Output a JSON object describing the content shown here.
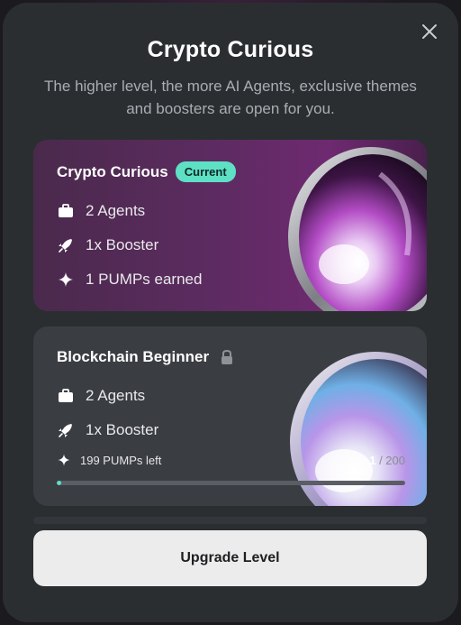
{
  "modal": {
    "title": "Crypto Curious",
    "subtitle": "The higher level, the more AI Agents, exclusive themes and boosters are open for you.",
    "close_icon": "close-icon"
  },
  "current_level": {
    "name": "Crypto Curious",
    "badge": "Current",
    "features": [
      {
        "icon": "briefcase-icon",
        "text": "2 Agents"
      },
      {
        "icon": "rocket-icon",
        "text": "1x Booster"
      },
      {
        "icon": "sparkle-icon",
        "text": "1 PUMPs earned"
      }
    ]
  },
  "next_level": {
    "name": "Blockchain Beginner",
    "lock_icon": "lock-icon",
    "features": [
      {
        "icon": "briefcase-icon",
        "text": "2 Agents"
      },
      {
        "icon": "rocket-icon",
        "text": "1x Booster"
      }
    ],
    "pumps_left": "199 PUMPs left",
    "progress_current": "1",
    "progress_total": "/ 200",
    "progress_fraction": 0.005
  },
  "upgrade_button": {
    "label": "Upgrade Level"
  },
  "colors": {
    "accent": "#5ee0c5",
    "modal_bg": "#2b2e31",
    "card_current_bg": "#5c2b60",
    "card_next_bg": "#3a3d42",
    "button_bg": "#ececec"
  }
}
